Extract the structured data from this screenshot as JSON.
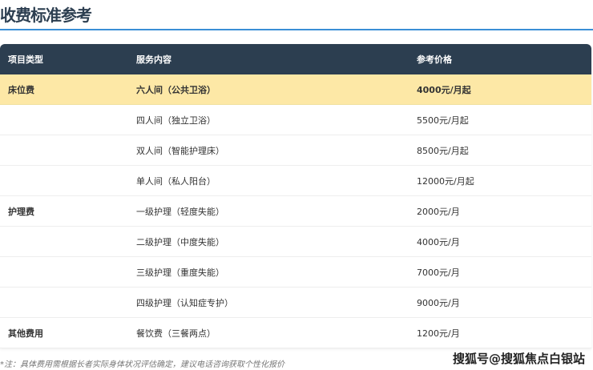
{
  "title": "收费标准参考",
  "headers": [
    "项目类型",
    "服务内容",
    "参考价格"
  ],
  "rows": [
    {
      "type": "床位费",
      "service": "六人间（公共卫浴）",
      "price": "4000元/月起",
      "highlight": true
    },
    {
      "type": "",
      "service": "四人间（独立卫浴）",
      "price": "5500元/月起"
    },
    {
      "type": "",
      "service": "双人间（智能护理床）",
      "price": "8500元/月起"
    },
    {
      "type": "",
      "service": "单人间（私人阳台）",
      "price": "12000元/月起"
    },
    {
      "type": "护理费",
      "service": "一级护理（轻度失能）",
      "price": "2000元/月"
    },
    {
      "type": "",
      "service": "二级护理（中度失能）",
      "price": "4000元/月"
    },
    {
      "type": "",
      "service": "三级护理（重度失能）",
      "price": "7000元/月"
    },
    {
      "type": "",
      "service": "四级护理（认知症专护）",
      "price": "9000元/月"
    },
    {
      "type": "其他费用",
      "service": "餐饮费（三餐两点）",
      "price": "1200元/月"
    }
  ],
  "note": "*注：具体费用需根据长者实际身体状况评估确定，建议电话咨询获取个性化报价",
  "watermark": "搜狐号@搜狐焦点白银站"
}
